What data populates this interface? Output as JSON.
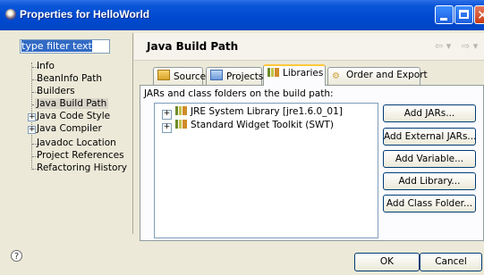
{
  "window": {
    "title": "Properties for HelloWorld"
  },
  "filter": {
    "value": "type filter text"
  },
  "nav": {
    "items": [
      {
        "label": "Info"
      },
      {
        "label": "BeanInfo Path"
      },
      {
        "label": "Builders"
      },
      {
        "label": "Java Build Path",
        "selected": true
      },
      {
        "label": "Java Code Style",
        "expandable": true
      },
      {
        "label": "Java Compiler",
        "expandable": true
      },
      {
        "label": "Javadoc Location"
      },
      {
        "label": "Project References"
      },
      {
        "label": "Refactoring History"
      }
    ]
  },
  "page": {
    "title": "Java Build Path"
  },
  "tabs": [
    {
      "label": "Source"
    },
    {
      "label": "Projects"
    },
    {
      "label": "Libraries",
      "active": true
    },
    {
      "label": "Order and Export"
    }
  ],
  "libraries": {
    "label": "JARs and class folders on the build path:",
    "items": [
      {
        "label": "JRE System Library [jre1.6.0_01]"
      },
      {
        "label": "Standard Widget Toolkit (SWT)"
      }
    ]
  },
  "buttons": {
    "add_jars": "Add JARs...",
    "add_external_jars": "Add External JARs...",
    "add_variable": "Add Variable...",
    "add_library": "Add Library...",
    "add_class_folder": "Add Class Folder..."
  },
  "footer": {
    "ok": "OK",
    "cancel": "Cancel"
  },
  "colors": {
    "title_bar": "#0049cf",
    "dialog_bg": "#ece9d8",
    "selection": "#316ac5",
    "active_tab": "#ffc83c"
  }
}
